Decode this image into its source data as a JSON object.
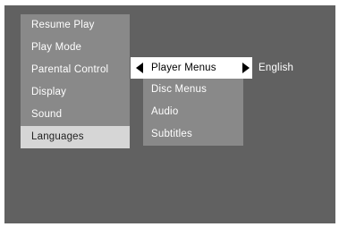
{
  "main_menu": {
    "items": [
      {
        "label": "Resume Play"
      },
      {
        "label": "Play Mode"
      },
      {
        "label": "Parental Control"
      },
      {
        "label": "Display"
      },
      {
        "label": "Sound"
      },
      {
        "label": "Languages"
      }
    ],
    "selected": "Languages"
  },
  "sub_menu": {
    "active_label": "Player Menus",
    "items": [
      {
        "label": "Disc Menus"
      },
      {
        "label": "Audio"
      },
      {
        "label": "Subtitles"
      }
    ]
  },
  "current_value": "English",
  "icons": {
    "left": "triangle-left-icon",
    "right": "triangle-right-icon"
  }
}
